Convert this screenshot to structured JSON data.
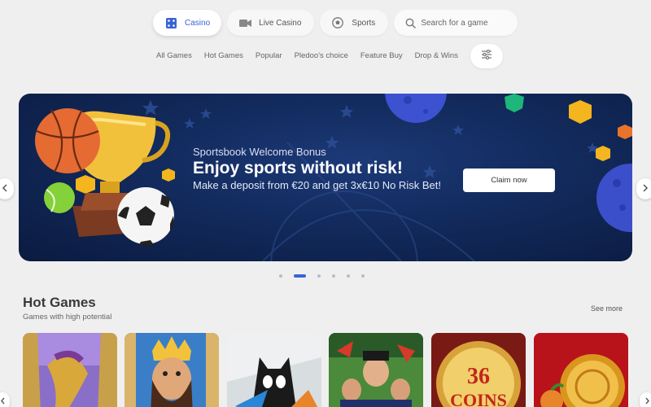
{
  "nav": {
    "tabs": [
      {
        "label": "Casino",
        "icon": "dice-icon",
        "active": true
      },
      {
        "label": "Live Casino",
        "icon": "video-camera-icon",
        "active": false
      },
      {
        "label": "Sports",
        "icon": "soccer-ball-icon",
        "active": false
      }
    ],
    "search_placeholder": "Search for a game"
  },
  "filters": [
    "All Games",
    "Hot Games",
    "Popular",
    "Pledoo's choice",
    "Feature Buy",
    "Drop & Wins"
  ],
  "banner": {
    "subtitle": "Sportsbook Welcome Bonus",
    "title": "Enjoy sports without risk!",
    "description": "Make a deposit from €20 and get 3x€10 No Risk Bet!",
    "cta": "Claim now"
  },
  "carousel": {
    "total_slides": 6,
    "active_slide": 2
  },
  "hot_games": {
    "title": "Hot Games",
    "subtitle": "Games with high potential",
    "see_more": "See more",
    "tiles": [
      {
        "name": "game-tile-golden-warrior"
      },
      {
        "name": "game-tile-king"
      },
      {
        "name": "game-tile-cat"
      },
      {
        "name": "game-tile-mobsters"
      },
      {
        "name": "game-tile-36-coins",
        "text": "36 COINS"
      },
      {
        "name": "game-tile-gold-coin"
      }
    ]
  },
  "colors": {
    "accent": "#3b63d6",
    "banner_bg": "#122a5c",
    "page_bg": "#efeff0"
  }
}
